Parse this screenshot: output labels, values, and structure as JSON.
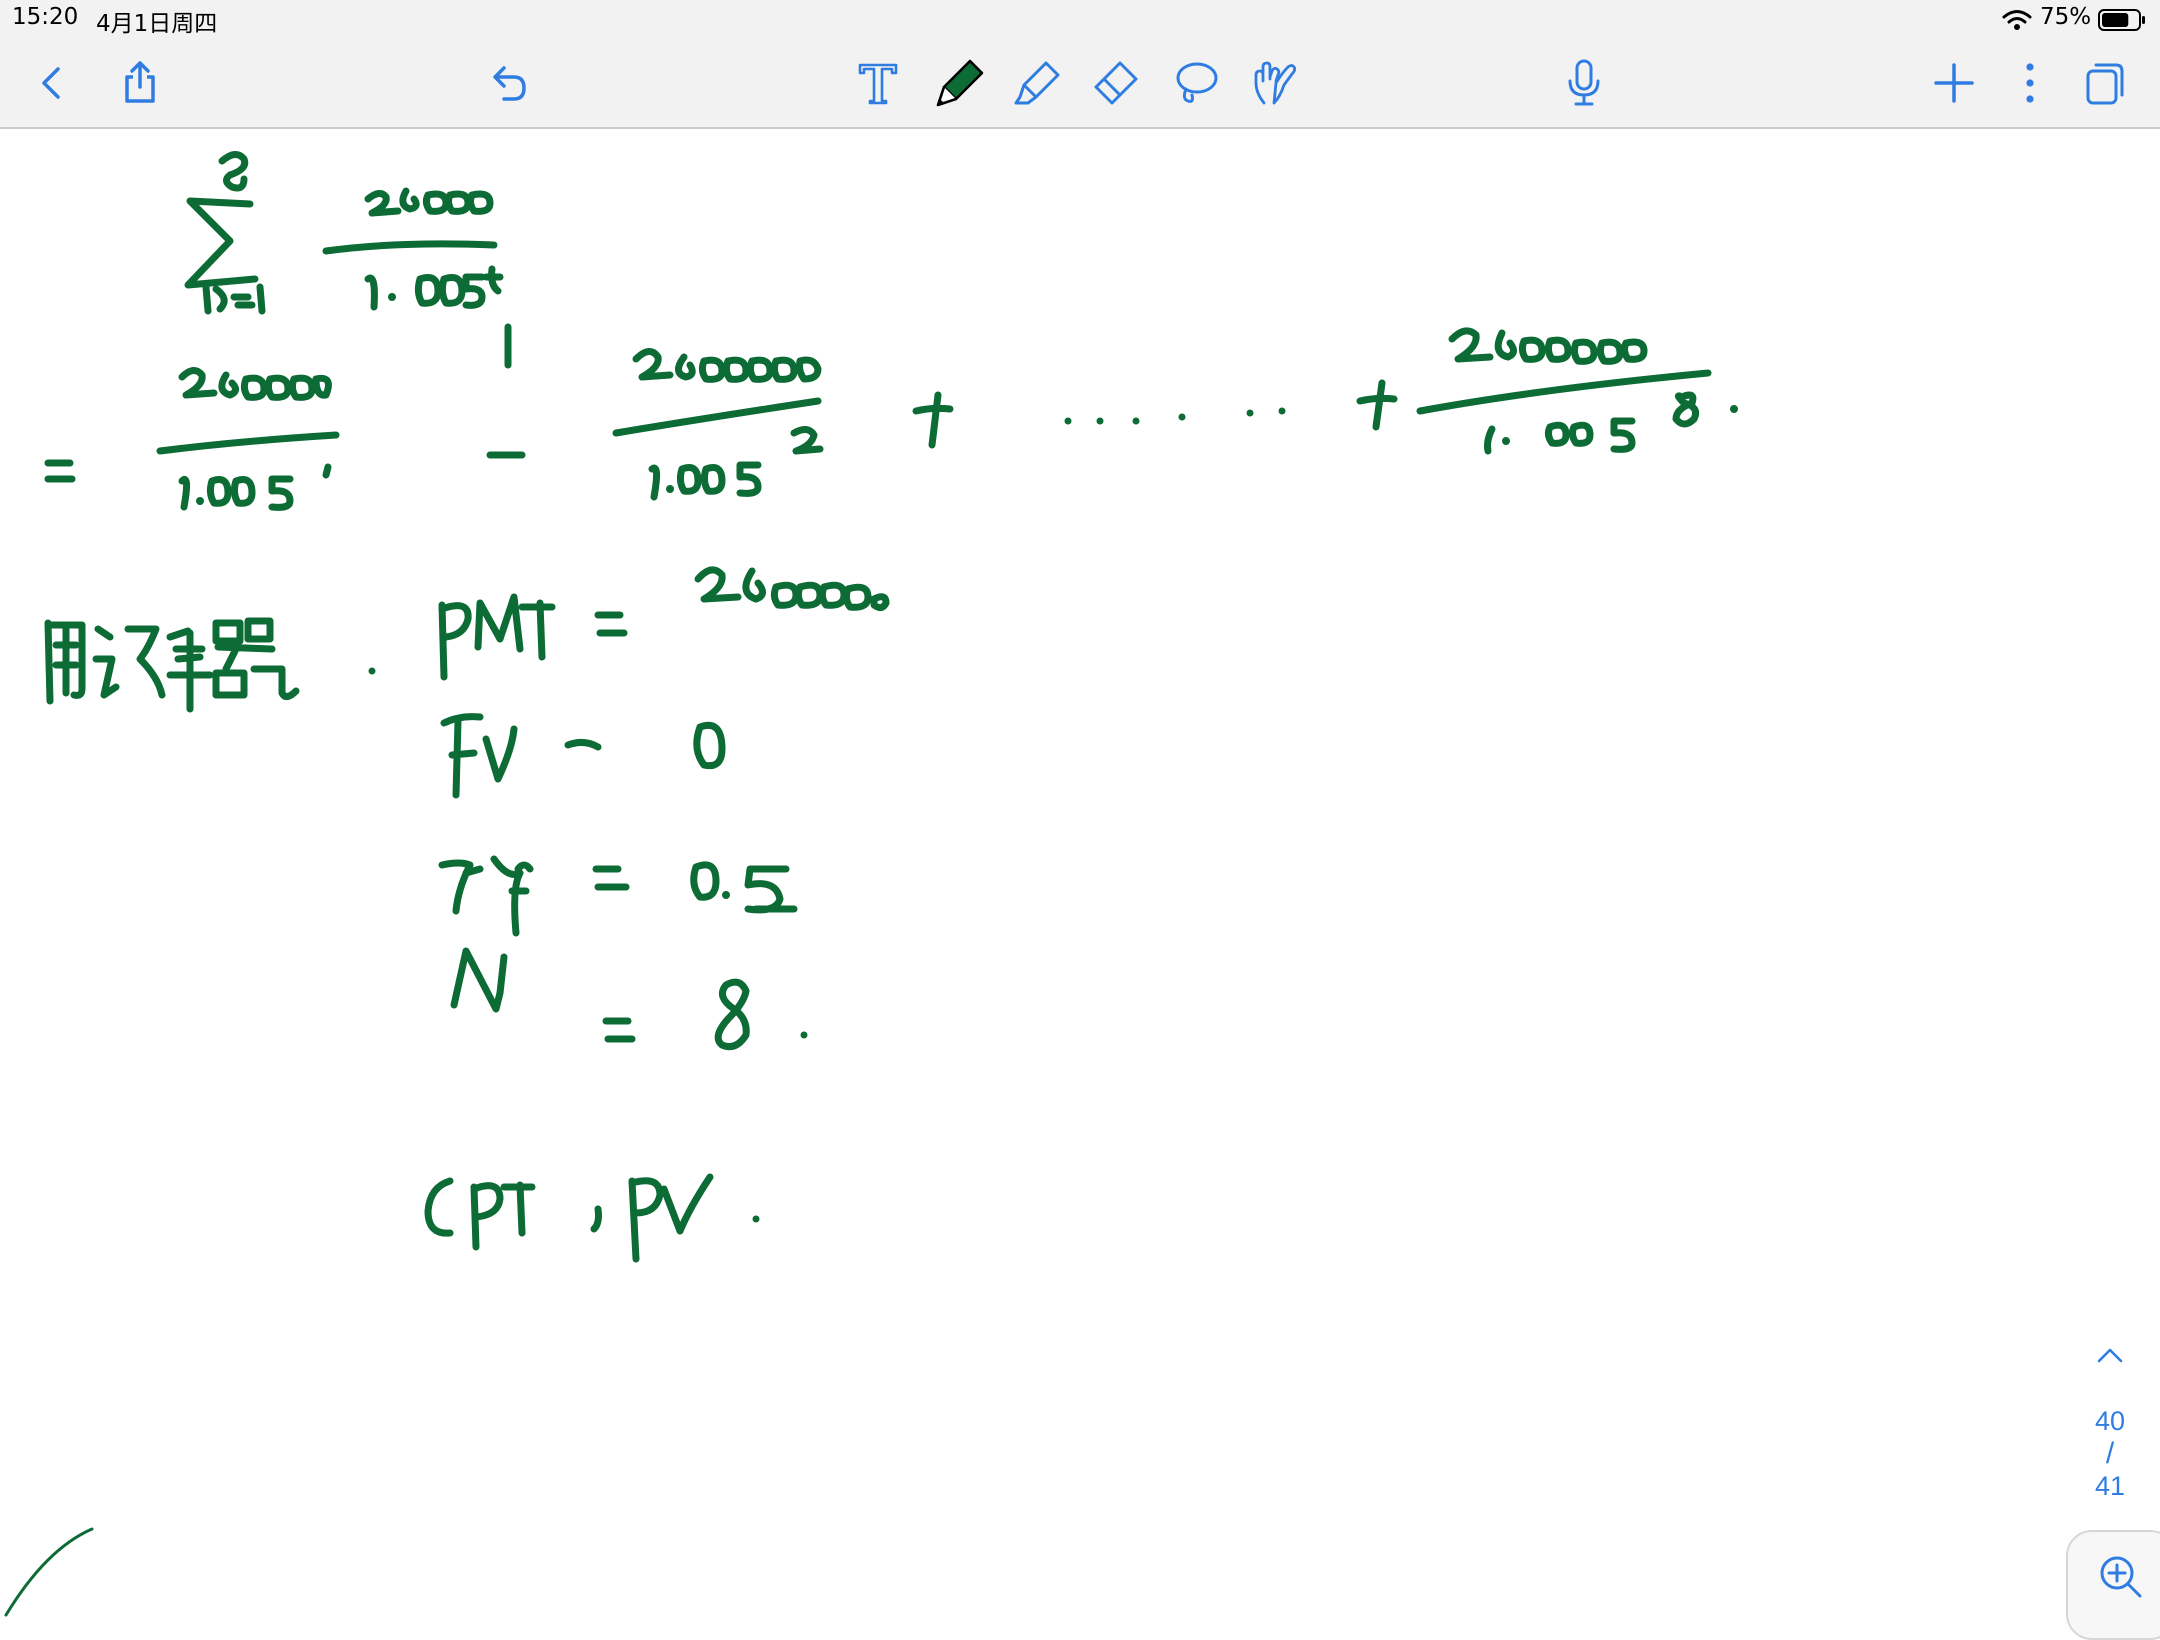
{
  "status_bar": {
    "time": "15:20",
    "date": "4月1日周四",
    "battery_percent": "75%",
    "battery_level": 0.75,
    "wifi_icon": "wifi-icon",
    "battery_icon": "battery-icon"
  },
  "toolbar": {
    "accent_color": "#2f7de1",
    "left_tools": [
      "back-chevron-icon",
      "share-icon",
      "undo-icon"
    ],
    "drawing_tools": [
      "text-tool-icon",
      "pen-tool-icon",
      "highlighter-tool-icon",
      "eraser-tool-icon",
      "lasso-tool-icon",
      "hand-tool-icon"
    ],
    "active_tool": "pen-tool-icon",
    "active_pen_color": "#0d6b35",
    "right_tools": [
      "microphone-icon",
      "add-icon",
      "more-icon",
      "pages-icon"
    ]
  },
  "note": {
    "ink_color": "#0d6b35",
    "handwriting": {
      "summation": "Σ(t=1 to 8) 260000 / 1.005^t",
      "expansion": "= 260000/1.005¹ + 260000/1.005² + ...... + 260000/1.005⁸.",
      "calculator_label": "用计算器 .",
      "pmt_line": "PMT = 260000",
      "fv_line": "FV = 0",
      "iy_line": "I/Y = 0.5",
      "n_line": "N = 8.",
      "cpt_line": "CPT , PV ."
    }
  },
  "pager": {
    "current_page": "40",
    "separator": "/",
    "total_pages": "41"
  },
  "zoom_icon": "zoom-in-icon"
}
